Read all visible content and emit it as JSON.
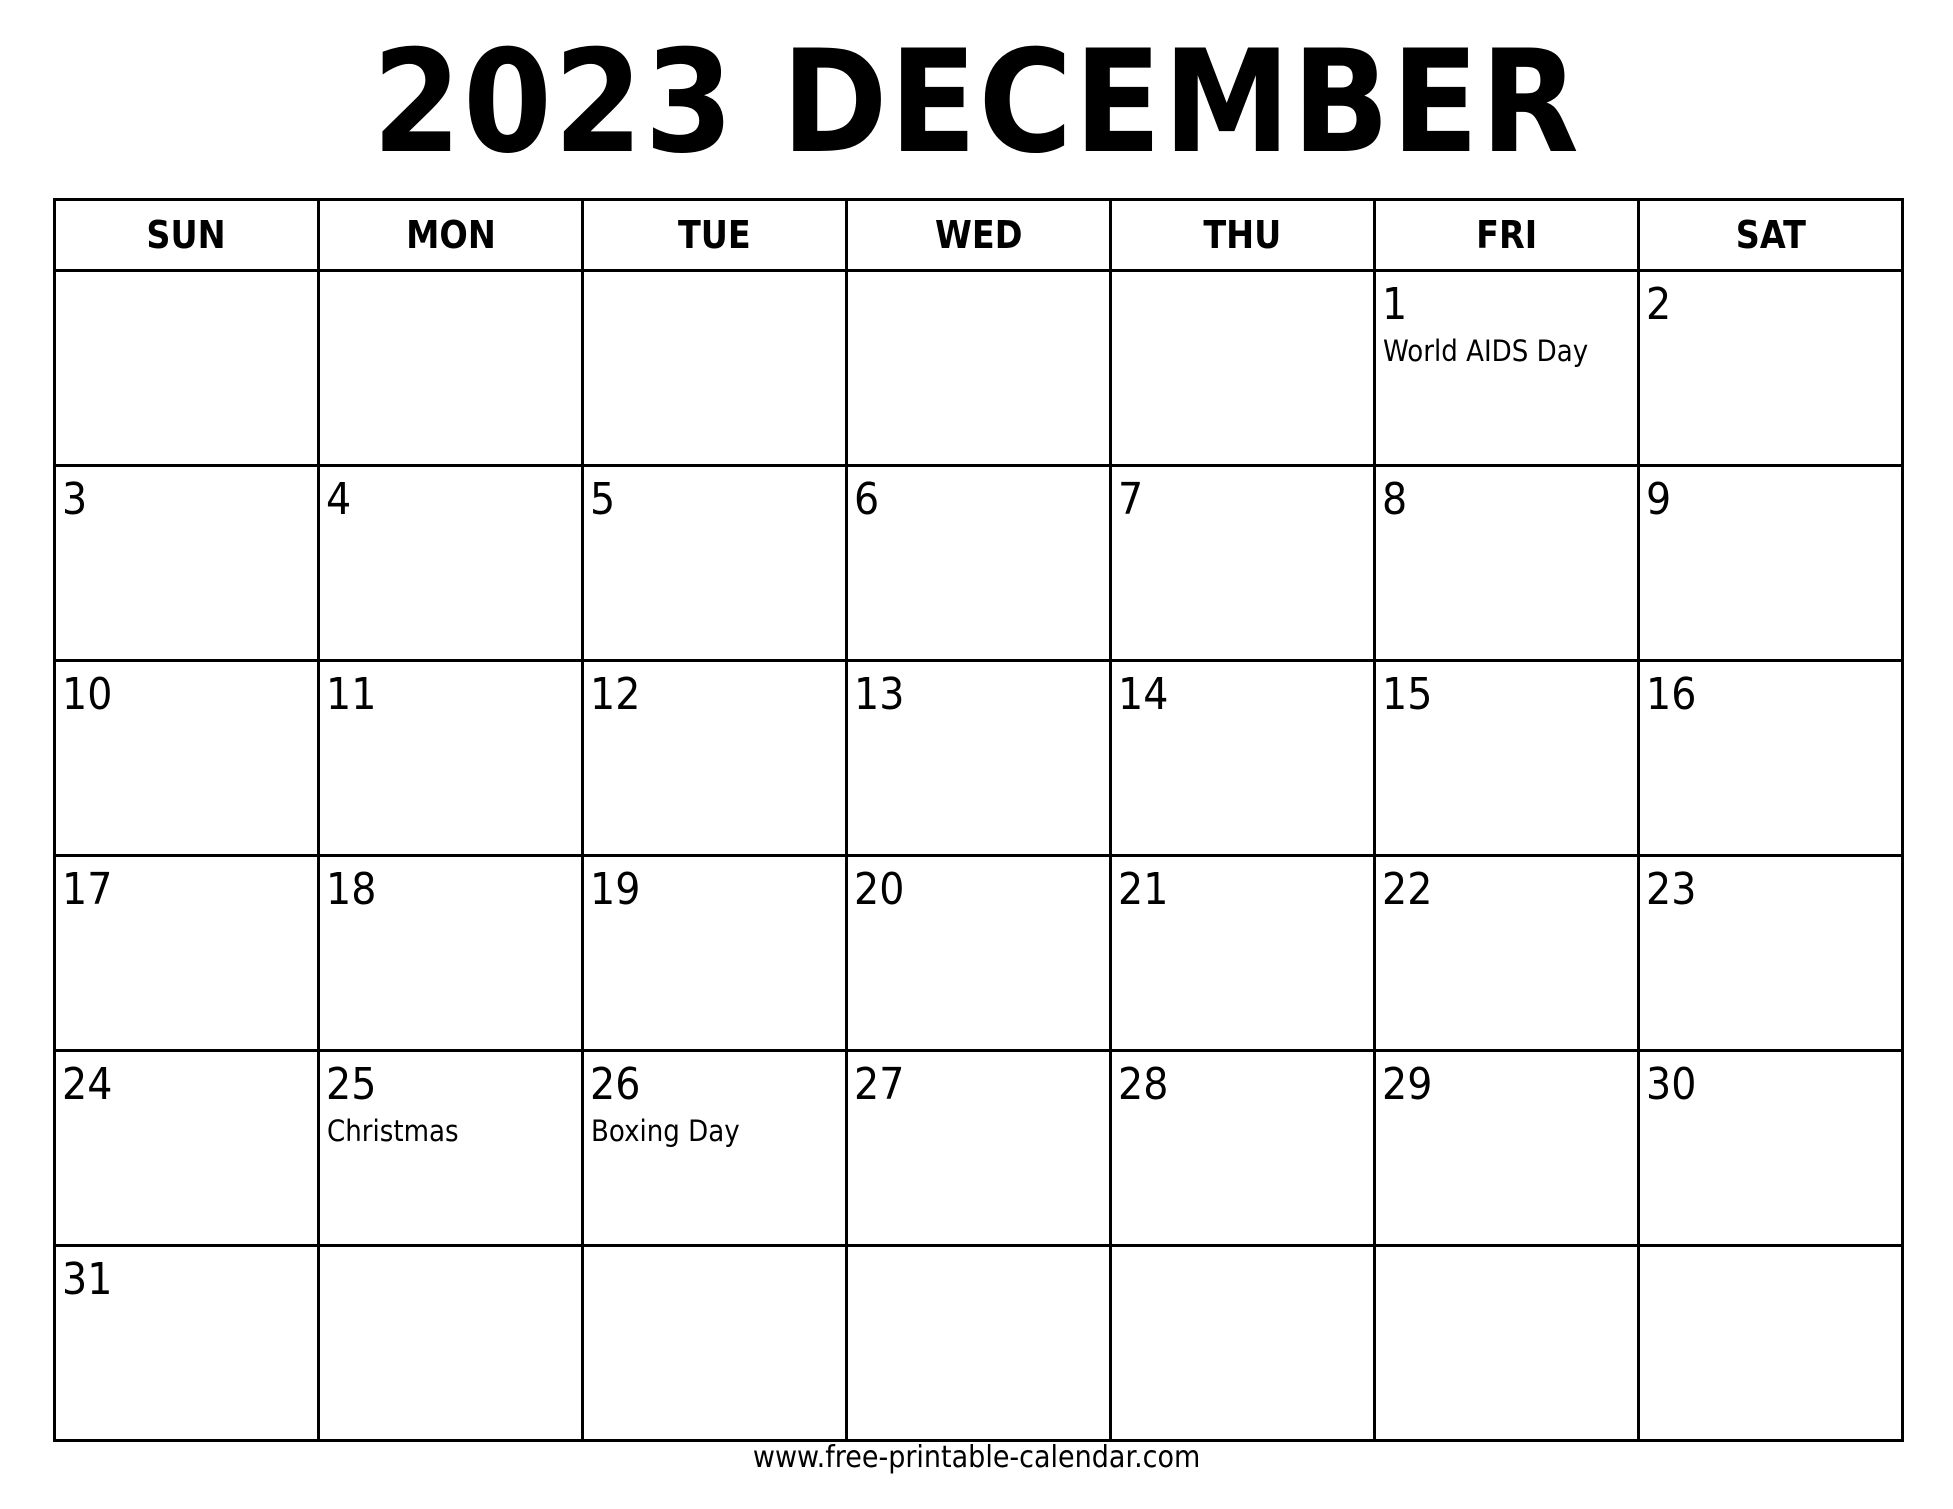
{
  "title": "2023 DECEMBER",
  "weekdays": [
    "SUN",
    "MON",
    "TUE",
    "WED",
    "THU",
    "FRI",
    "SAT"
  ],
  "weeks": [
    [
      {
        "day": "",
        "holiday": ""
      },
      {
        "day": "",
        "holiday": ""
      },
      {
        "day": "",
        "holiday": ""
      },
      {
        "day": "",
        "holiday": ""
      },
      {
        "day": "",
        "holiday": ""
      },
      {
        "day": "1",
        "holiday": "World AIDS Day"
      },
      {
        "day": "2",
        "holiday": ""
      }
    ],
    [
      {
        "day": "3",
        "holiday": ""
      },
      {
        "day": "4",
        "holiday": ""
      },
      {
        "day": "5",
        "holiday": ""
      },
      {
        "day": "6",
        "holiday": ""
      },
      {
        "day": "7",
        "holiday": ""
      },
      {
        "day": "8",
        "holiday": ""
      },
      {
        "day": "9",
        "holiday": ""
      }
    ],
    [
      {
        "day": "10",
        "holiday": ""
      },
      {
        "day": "11",
        "holiday": ""
      },
      {
        "day": "12",
        "holiday": ""
      },
      {
        "day": "13",
        "holiday": ""
      },
      {
        "day": "14",
        "holiday": ""
      },
      {
        "day": "15",
        "holiday": ""
      },
      {
        "day": "16",
        "holiday": ""
      }
    ],
    [
      {
        "day": "17",
        "holiday": ""
      },
      {
        "day": "18",
        "holiday": ""
      },
      {
        "day": "19",
        "holiday": ""
      },
      {
        "day": "20",
        "holiday": ""
      },
      {
        "day": "21",
        "holiday": ""
      },
      {
        "day": "22",
        "holiday": ""
      },
      {
        "day": "23",
        "holiday": ""
      }
    ],
    [
      {
        "day": "24",
        "holiday": ""
      },
      {
        "day": "25",
        "holiday": "Christmas"
      },
      {
        "day": "26",
        "holiday": "Boxing Day"
      },
      {
        "day": "27",
        "holiday": ""
      },
      {
        "day": "28",
        "holiday": ""
      },
      {
        "day": "29",
        "holiday": ""
      },
      {
        "day": "30",
        "holiday": ""
      }
    ],
    [
      {
        "day": "31",
        "holiday": ""
      },
      {
        "day": "",
        "holiday": ""
      },
      {
        "day": "",
        "holiday": ""
      },
      {
        "day": "",
        "holiday": ""
      },
      {
        "day": "",
        "holiday": ""
      },
      {
        "day": "",
        "holiday": ""
      },
      {
        "day": "",
        "holiday": ""
      }
    ]
  ],
  "footer": "www.free-printable-calendar.com"
}
